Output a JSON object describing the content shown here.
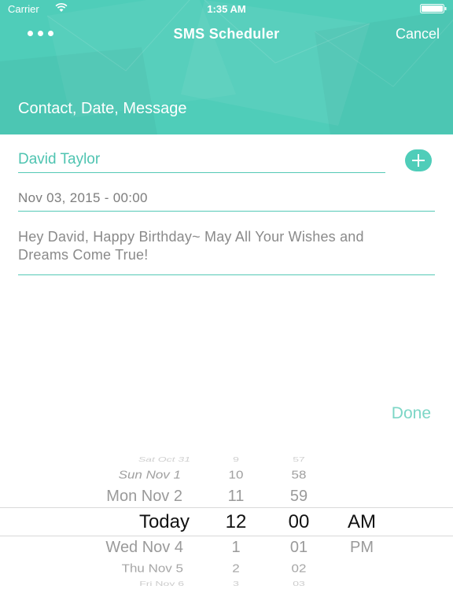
{
  "status_bar": {
    "carrier": "Carrier",
    "time": "1:35 AM"
  },
  "nav": {
    "title": "SMS Scheduler",
    "cancel_label": "Cancel"
  },
  "header": {
    "subtitle": "Contact, Date, Message",
    "accent_color": "#4fcdb9"
  },
  "form": {
    "contact": "David Taylor",
    "date": "Nov 03, 2015 - 00:00",
    "message": "Hey David, Happy Birthday~ May All Your Wishes and Dreams Come True!"
  },
  "done_label": "Done",
  "picker": {
    "days": [
      "Sat Oct 31",
      "Sun Nov 1",
      "Mon Nov 2",
      "Today",
      "Wed Nov 4",
      "Thu Nov 5",
      "Fri Nov 6"
    ],
    "hours": [
      "9",
      "10",
      "11",
      "12",
      "1",
      "2",
      "3"
    ],
    "minutes": [
      "57",
      "58",
      "59",
      "00",
      "01",
      "02",
      "03"
    ],
    "periods": [
      "AM",
      "PM"
    ],
    "selected": {
      "day": "Today",
      "hour": "12",
      "minute": "00",
      "period": "AM"
    }
  }
}
